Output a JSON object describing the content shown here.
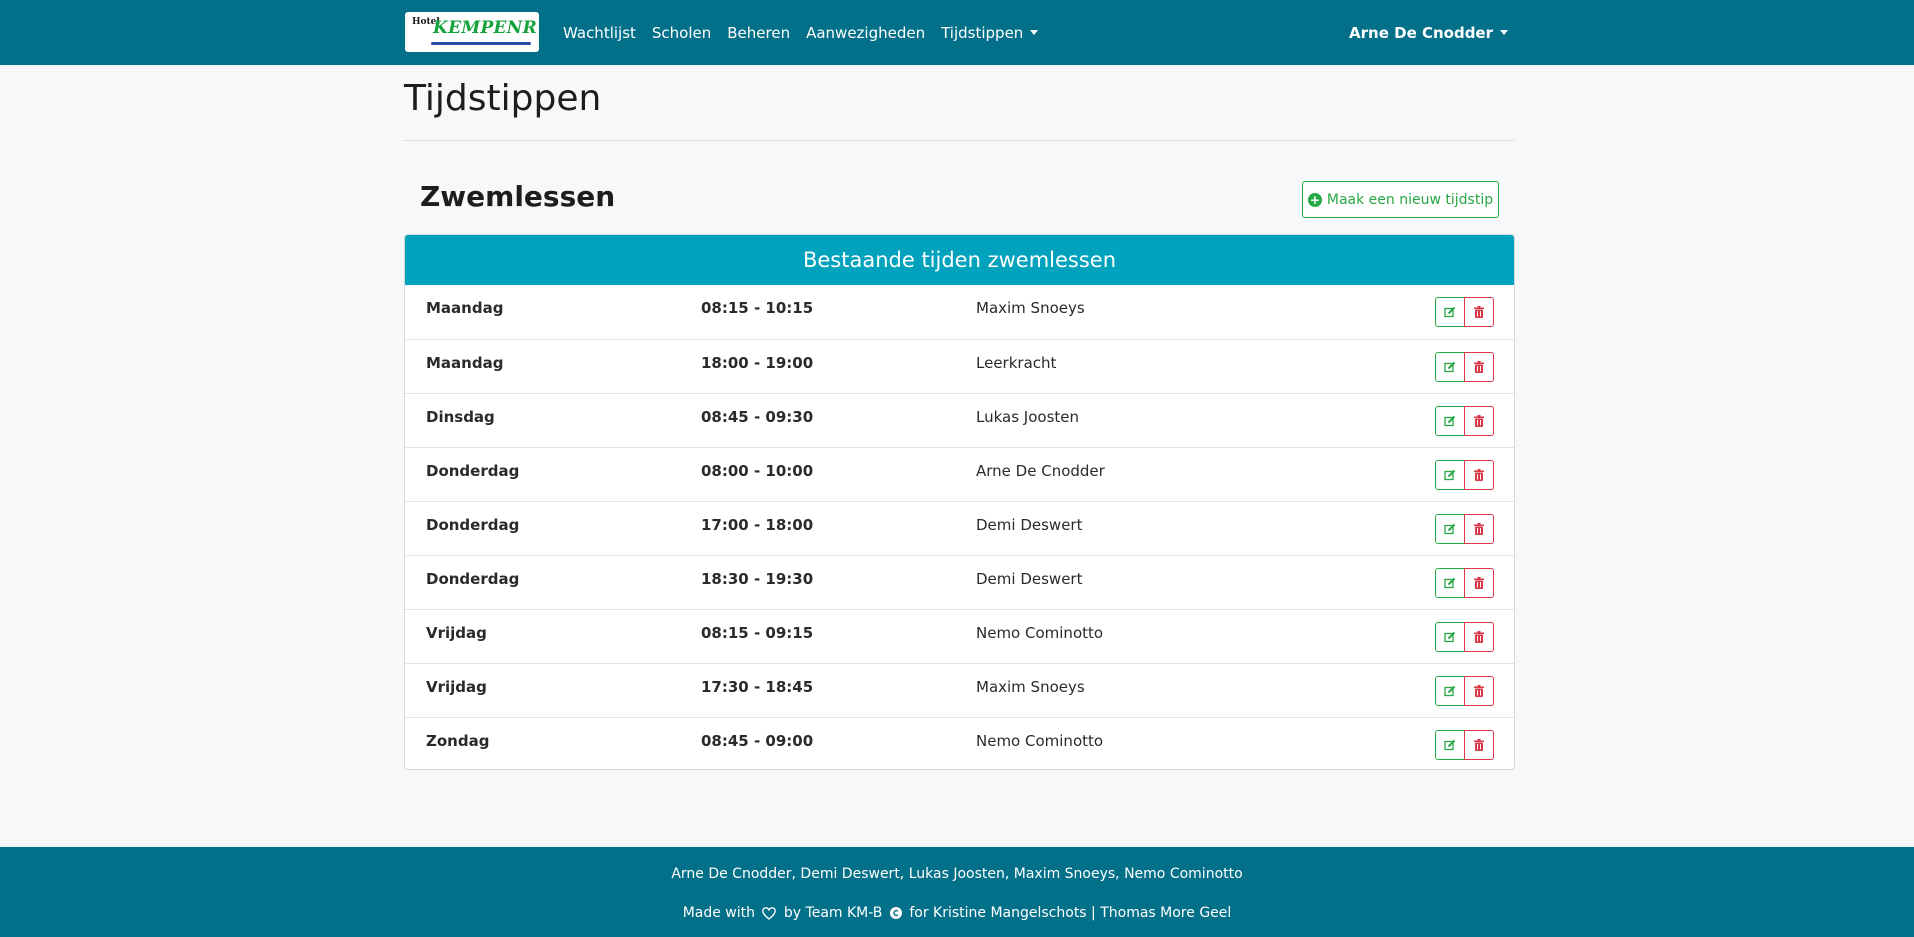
{
  "navbar": {
    "logo_small": "Hotel",
    "logo_brand": "KEMPENRUST",
    "items": [
      {
        "label": "Wachtlijst"
      },
      {
        "label": "Scholen"
      },
      {
        "label": "Beheren"
      },
      {
        "label": "Aanwezigheden"
      },
      {
        "label": "Tijdstippen"
      }
    ],
    "user": "Arne De Cnodder"
  },
  "page": {
    "title": "Tijdstippen",
    "section_title": "Zwemlessen",
    "new_button_label": "Maak een nieuw tijdstip"
  },
  "table": {
    "header": "Bestaande tijden zwemlessen",
    "rows": [
      {
        "day": "Maandag",
        "time": "08:15 - 10:15",
        "teacher": "Maxim Snoeys"
      },
      {
        "day": "Maandag",
        "time": "18:00 - 19:00",
        "teacher": "Leerkracht"
      },
      {
        "day": "Dinsdag",
        "time": "08:45 - 09:30",
        "teacher": "Lukas Joosten"
      },
      {
        "day": "Donderdag",
        "time": "08:00 - 10:00",
        "teacher": "Arne De Cnodder"
      },
      {
        "day": "Donderdag",
        "time": "17:00 - 18:00",
        "teacher": "Demi Deswert"
      },
      {
        "day": "Donderdag",
        "time": "18:30 - 19:30",
        "teacher": "Demi Deswert"
      },
      {
        "day": "Vrijdag",
        "time": "08:15 - 09:15",
        "teacher": "Nemo Cominotto"
      },
      {
        "day": "Vrijdag",
        "time": "17:30 - 18:45",
        "teacher": "Maxim Snoeys"
      },
      {
        "day": "Zondag",
        "time": "08:45 - 09:00",
        "teacher": "Nemo Cominotto"
      }
    ]
  },
  "footer": {
    "authors": "Arne De Cnodder, Demi Deswert, Lukas Joosten, Maxim Snoeys, Nemo Cominotto",
    "made_with": "Made with",
    "by_team": "by Team KM-B",
    "for_text": "for Kristine Mangelschots | Thomas More Geel"
  },
  "icons": {
    "edit": "edit-icon",
    "delete": "trash-icon",
    "add": "plus-circle-icon",
    "heart": "heart-icon",
    "copyright": "copyright-icon"
  },
  "colors": {
    "navbar": "#037089",
    "card_header": "#00a2bd",
    "success": "#28a745",
    "danger": "#dc3545"
  }
}
